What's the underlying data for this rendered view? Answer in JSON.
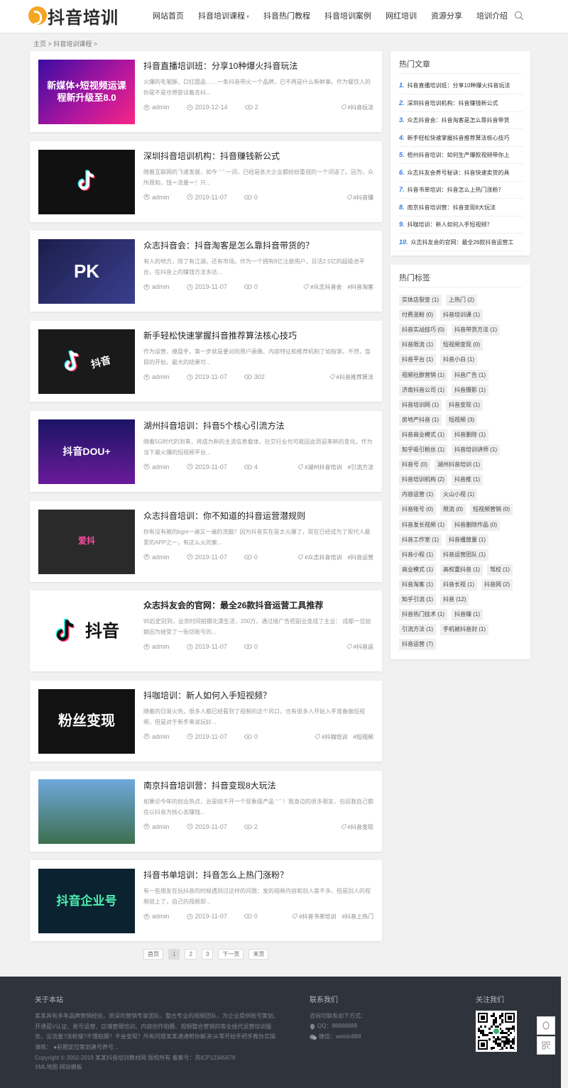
{
  "header": {
    "logo_text": "抖音培训",
    "nav": [
      {
        "label": "网站首页"
      },
      {
        "label": "抖音培训课程",
        "caret": "▾"
      },
      {
        "label": "抖音热门教程"
      },
      {
        "label": "抖音培训案例"
      },
      {
        "label": "网红培训"
      },
      {
        "label": "资源分享"
      },
      {
        "label": "培训介绍"
      }
    ],
    "search_icon": "search-icon"
  },
  "breadcrumb": "主页 > 抖音培训课程 >",
  "posts": [
    {
      "title": "抖音直播培训班：分享10种爆火抖音玩法",
      "excerpt": "火爆的毛笔酥、口红甜品……一条抖音带火一个品牌，已不再是什么新鲜事。作为餐饮人的你是不是也想尝试着去抖...",
      "author": "admin",
      "date": "2019-12-14",
      "views": "2",
      "tags": [
        "#抖音玩法"
      ],
      "thumb_text": "新媒体+短视频运课程新升级至8.0",
      "bold": false
    },
    {
      "title": "深圳抖音培训机构：抖音赚钱新公式",
      "excerpt": "随着互联网的飞速发展，如今 “ ” 一词，已经是各大企业都纷纷重视的一个词语了。因为，众所周知，钱＝流量＝！只...",
      "author": "admin",
      "date": "2019-11-07",
      "views": "0",
      "tags": [
        "#抖音赚"
      ],
      "thumb_text": "",
      "bold": false
    },
    {
      "title": "众志抖音会：抖音淘客是怎么靠抖音带货的？",
      "excerpt": "有人的地方，除了有江湖，还有市场。作为一个拥有8亿注册用户，日活2.5亿的超级池平台，在抖音上的赚钱方法多达...",
      "author": "admin",
      "date": "2019-11-07",
      "views": "0",
      "tags": [
        "#众志抖音会",
        "#抖音淘客"
      ],
      "thumb_text": "PK",
      "bold": false
    },
    {
      "title": "新手轻松快速掌握抖音推荐算法核心技巧",
      "excerpt": "作为运营，摸盘手，第一步就是要对的用户画像、内容特征和推荐机制了如指掌。不然，盲目的开始，最大的结果可...",
      "author": "admin",
      "date": "2019-11-07",
      "views": "302",
      "tags": [
        "#抖音推荐算法"
      ],
      "thumb_text": "抖音",
      "bold": false
    },
    {
      "title": "湖州抖音培训：抖音5个核心引流方法",
      "excerpt": "随着5G时代的到来，将成为新的主流信息载体，社交行业也可能因此而迎来新的变化。作为当下最火爆的短视频平台...",
      "author": "admin",
      "date": "2019-11-07",
      "views": "4",
      "tags": [
        "#湖州抖音培训",
        "#引流方法"
      ],
      "thumb_text": "抖音DOU+",
      "bold": false
    },
    {
      "title": "众志抖音培训：你不知道的抖音运营潜规则",
      "excerpt": "你有没有被的bgm一遍又一遍的洗脑？因为抖音实在是太火爆了，现在已经成为了现代人最爱的APP之一，有这么火的案...",
      "author": "admin",
      "date": "2019-11-07",
      "views": "0",
      "tags": [
        "#众志抖音培训",
        "#抖音运营"
      ],
      "thumb_text": "爱抖",
      "bold": false
    },
    {
      "title": "众志抖友会的官网：最全26款抖音运营工具推荐",
      "excerpt": "95后史别到，业余时间拍摄北漂生活，200万，通过接广告把副业变成了主业： 成都一位姑娘因为接受了一街坊账号的...",
      "author": "admin",
      "date": "2019-11-07",
      "views": "0",
      "tags": [
        "#抖音运"
      ],
      "thumb_text": "抖音",
      "bold": true
    },
    {
      "title": "抖咖培训：新人如何入手短视频？",
      "excerpt": "随着的日渐火热，很多人都已经看到了视频的这个风口，也有很多人开始入手准备做短视频，但是对于新手来说玩好...",
      "author": "admin",
      "date": "2019-11-07",
      "views": "0",
      "tags": [
        "#抖咖培训",
        "#短视频"
      ],
      "thumb_text": "粉丝变现",
      "bold": false
    },
    {
      "title": "南京抖音培训营：抖音变现8大玩法",
      "excerpt": "如果论今年的创业热点，总是绕不开一个现象级产品 “ ” ！我身边的很多朋友，包括我自己都在以抖音为核心去赚钱...",
      "author": "admin",
      "date": "2019-11-07",
      "views": "2",
      "tags": [
        "#抖音变现"
      ],
      "thumb_text": "",
      "bold": false
    },
    {
      "title": "抖音书单培训：抖音怎么上热门涨粉？",
      "excerpt": "有一些朋友在玩抖音的时候遇到过这样的问题：发的视频内容和别人差不多，但是别人的视频就上了，自己的视频却...",
      "author": "admin",
      "date": "2019-11-07",
      "views": "0",
      "tags": [
        "#抖音书单培训",
        "#抖音上热门"
      ],
      "thumb_text": "抖音企业号",
      "bold": false
    }
  ],
  "pagination": [
    "首页",
    "1",
    "2",
    "3",
    "下一页",
    "末页"
  ],
  "sidebar": {
    "hot_title": "热门文章",
    "hot": [
      {
        "n": "1.",
        "t": "抖音直播培训班：分享10种爆火抖音玩法"
      },
      {
        "n": "2.",
        "t": "深圳抖音培训机构：抖音赚钱新公式"
      },
      {
        "n": "3.",
        "t": "众志抖音会：抖音淘客是怎么靠抖音带货"
      },
      {
        "n": "4.",
        "t": "新手轻松快速掌握抖音推荐算法核心技巧"
      },
      {
        "n": "5.",
        "t": "梧州抖音培训：如何生产爆款视频带你上"
      },
      {
        "n": "6.",
        "t": "众志抖友会养号秘诀：抖音快速卖货的具"
      },
      {
        "n": "7.",
        "t": "抖音书单培训：抖音怎么上热门涨粉？"
      },
      {
        "n": "8.",
        "t": "南京抖音培训营：抖音变现8大玩法"
      },
      {
        "n": "9.",
        "t": "抖咖培训：新人如何入手短视频？"
      },
      {
        "n": "10.",
        "t": "众志抖友会的官网：最全26款抖音运营工"
      }
    ],
    "tags_title": "热门标签",
    "tags": [
      [
        "实体店裂变 (1)",
        "上热门 (2)"
      ],
      [
        "付费涨粉 (0)",
        "抖音培训课 (1)"
      ],
      [
        "抖音实战技巧 (0)",
        "抖音带货方法 (1)"
      ],
      [
        "抖音限流 (1)",
        "短视频变现 (0)"
      ],
      [
        "抖音平台 (1)",
        "抖音小白 (1)"
      ],
      [
        "视频社群营销 (1)",
        "抖音广告 (1)"
      ],
      [
        "济南抖音公司 (1)",
        "抖音摄影 (1)"
      ],
      [
        "抖音培训网 (1)",
        "抖音变现 (1)"
      ],
      [
        "房地产抖音 (1)",
        "短视频 (3)"
      ],
      [
        "抖音商业模式 (1)",
        "抖音删除 (1)"
      ],
      [
        "知乎吸引粉丝 (1)",
        "抖音培训讲师 (1)"
      ],
      [
        "抖音号 (0)",
        "湖州抖音培训 (1)"
      ],
      [
        "抖音培训机构 (2)",
        "抖音推 (1)"
      ],
      [
        "内容运营 (1)",
        "火山小视 (1)"
      ],
      [
        "抖音账号 (0)",
        "限流 (0)",
        "短视频营销 (0)"
      ],
      [
        "抖音发长视频 (1)",
        "抖音删除作品 (0)"
      ],
      [
        "抖音工作室 (1)",
        "抖音播放量 (1)"
      ],
      [
        "抖音小程 (1)",
        "抖音运营团队 (1)"
      ],
      [
        "商业模式 (1)",
        "高权重抖音 (1)",
        "驾校 (1)"
      ],
      [
        "抖音淘客 (1)",
        "抖音长视 (1)",
        "抖音网 (2)"
      ],
      [
        "知乎引流 (1)",
        "抖音 (12)"
      ],
      [
        "抖音热门技术 (1)",
        "抖音赚 (1)"
      ],
      [
        "引流方法 (1)",
        "手机被抖音封 (1)"
      ],
      [
        "抖音运营 (7)"
      ]
    ]
  },
  "footer": {
    "about_title": "关于本站",
    "about_text": "某某具有多年品牌营销经验，资深的营销专家团队，整合专业的视频团队，为企业提供账号策划、开通蓝V认证、账号运营、店铺管理培训、内容创作拍摄、视频整合营销的等全线代运营培训服务。没流量?涨粉慢?不懂拍摄？不会变现？所有问题某某通通帮你解决!从零开始手把手教你实操演练： ●前期定位策划建号养号...",
    "copyright": "Copyright © 2002-2019 某某抖音培训教材网 版权所有   备案号：苏ICP12345678",
    "links": "XML地图 网站模板",
    "contact_title": "联系我们",
    "contact_lines": [
      "咨询可联系如下方式：",
      "QQ：88888888",
      "微信：weixin888"
    ],
    "follow_title": "关注我们"
  },
  "colors": {
    "accent": "#2c7be5",
    "logo": "#f6a623",
    "footer_bg": "#2f333b"
  }
}
